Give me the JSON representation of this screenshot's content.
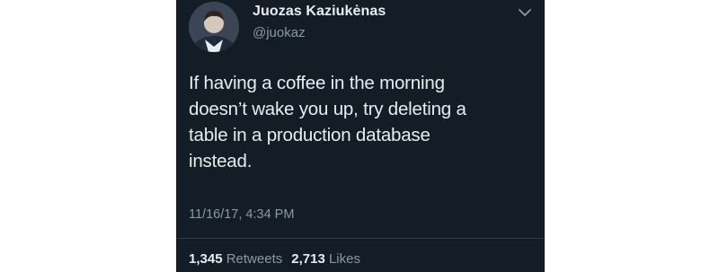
{
  "author": {
    "display_name": "Juozas Kaziukėnas",
    "handle": "@juokaz"
  },
  "tweet": {
    "lines": [
      "If having a coffee in the morning",
      "doesn’t wake you up, try deleting a",
      "table in a production database",
      "instead."
    ],
    "timestamp": "11/16/17, 4:34 PM"
  },
  "stats": {
    "retweets_count": "1,345",
    "retweets_label": "Retweets",
    "likes_count": "2,713",
    "likes_label": "Likes"
  },
  "icons": {
    "menu": "chevron-down-icon",
    "avatar": "avatar"
  },
  "colors": {
    "background": "#141d26",
    "primary_text": "#e8edf1",
    "secondary_text": "#8899a6"
  }
}
